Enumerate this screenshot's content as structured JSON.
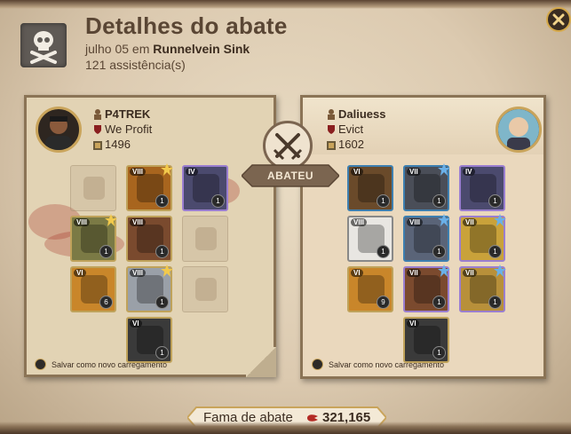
{
  "header": {
    "title": "Detalhes do abate",
    "date": "julho 05 em",
    "location": "Runnelvein Sink",
    "assists": "121 assistência(s)"
  },
  "killer": {
    "name": "P4TREK",
    "guild": "We Profit",
    "item_power": "1496",
    "equipment": [
      {
        "slot": "bag",
        "state": "empty",
        "icon": "bag-icon"
      },
      {
        "slot": "head",
        "state": "item",
        "icon": "leather-hood-icon",
        "tier": "VIII",
        "qty": "1",
        "frame": "#bfa25a",
        "bg": "#a8651e",
        "enchant": true
      },
      {
        "slot": "cape",
        "state": "item",
        "icon": "dark-cape-icon",
        "tier": "IV",
        "qty": "1",
        "frame": "#9a7ed0",
        "bg": "#4b4a6e",
        "enchant": false
      },
      {
        "slot": "mainhand",
        "state": "item",
        "icon": "golden-hammer-icon",
        "tier": "VIII",
        "qty": "1",
        "frame": "#bfa25a",
        "bg": "#7b7a45",
        "enchant": true
      },
      {
        "slot": "armor",
        "state": "item",
        "icon": "mercenary-jacket-icon",
        "tier": "VIII",
        "qty": "1",
        "frame": "#bfa25a",
        "bg": "#7a4a2e",
        "enchant": false
      },
      {
        "slot": "offhand",
        "state": "ghost",
        "icon": "golden-hammer-icon"
      },
      {
        "slot": "potion",
        "state": "item",
        "icon": "red-potion-icon",
        "tier": "VI",
        "qty": "6",
        "frame": "#bfa25a",
        "bg": "#c9862a",
        "enchant": false
      },
      {
        "slot": "shoes",
        "state": "item",
        "icon": "plate-boots-icon",
        "tier": "VIII",
        "qty": "1",
        "frame": "#bfa25a",
        "bg": "#9aa0a8",
        "enchant": true
      },
      {
        "slot": "food",
        "state": "empty",
        "icon": "fork-knife-icon"
      },
      {
        "slot": "mount",
        "state": "item",
        "icon": "panther-mount-icon",
        "tier": "VI",
        "qty": "1",
        "frame": "#bfa25a",
        "bg": "#3a3a3a",
        "enchant": false
      }
    ],
    "save_label": "Salvar como novo carregamento"
  },
  "victim": {
    "name": "Daliuess",
    "guild": "Evict",
    "item_power": "1602",
    "equipment": [
      {
        "slot": "bag",
        "state": "item",
        "icon": "leather-bag-icon",
        "tier": "VI",
        "qty": "1",
        "frame": "#3d7fb0",
        "bg": "#6a4a2a",
        "enchant": false
      },
      {
        "slot": "head",
        "state": "item",
        "icon": "dark-hood-icon",
        "tier": "VII",
        "qty": "1",
        "frame": "#3d7fb0",
        "bg": "#4a4e58",
        "enchant": true
      },
      {
        "slot": "cape",
        "state": "item",
        "icon": "dark-cape-icon",
        "tier": "IV",
        "qty": "1",
        "frame": "#9a7ed0",
        "bg": "#4b4a6e",
        "enchant": false
      },
      {
        "slot": "mainhand",
        "state": "item",
        "icon": "red-staff-icon",
        "tier": "VIII",
        "qty": "1",
        "frame": "#888",
        "bg": "#e8e6e2",
        "enchant": false
      },
      {
        "slot": "armor",
        "state": "item",
        "icon": "plate-armor-icon",
        "tier": "VIII",
        "qty": "1",
        "frame": "#3d7fb0",
        "bg": "#5a6478",
        "enchant": true
      },
      {
        "slot": "offhand",
        "state": "item",
        "icon": "tome-icon",
        "tier": "VII",
        "qty": "1",
        "frame": "#9a7ed0",
        "bg": "#c9a23a",
        "enchant": true
      },
      {
        "slot": "potion",
        "state": "item",
        "icon": "red-potion-icon",
        "tier": "VI",
        "qty": "9",
        "frame": "#bfa25a",
        "bg": "#c9862a",
        "enchant": false
      },
      {
        "slot": "shoes",
        "state": "item",
        "icon": "leather-boots-icon",
        "tier": "VII",
        "qty": "1",
        "frame": "#9a7ed0",
        "bg": "#7b4a2e",
        "enchant": true
      },
      {
        "slot": "food",
        "state": "item",
        "icon": "stew-bowl-icon",
        "tier": "VII",
        "qty": "1",
        "frame": "#9a7ed0",
        "bg": "#b8903a",
        "enchant": true
      },
      {
        "slot": "mount",
        "state": "item",
        "icon": "panther-mount-icon",
        "tier": "VI",
        "qty": "1",
        "frame": "#bfa25a",
        "bg": "#3a3a3a",
        "enchant": false
      }
    ],
    "save_label": "Salvar como novo carregamento"
  },
  "center": {
    "label": "ABATEU",
    "icon": "crossed-swords-icon"
  },
  "fame": {
    "label": "Fama de abate",
    "value": "321,165",
    "icon": "fame-icon"
  },
  "colors": {
    "accent": "#c9a45b",
    "ink": "#3b2c20",
    "banner": "#7b6550"
  }
}
